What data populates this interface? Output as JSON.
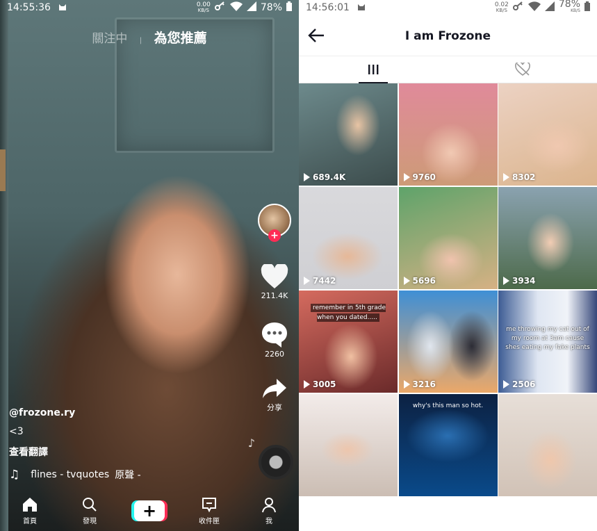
{
  "left": {
    "status": {
      "time": "14:55:36",
      "speed": "0.00",
      "speed_unit": "KB/S",
      "battery": "78%"
    },
    "feed_tabs": {
      "following": "關注中",
      "for_you": "為您推薦"
    },
    "rail": {
      "likes": "211.4K",
      "comments": "2260",
      "share": "分享"
    },
    "caption": {
      "username": "@frozone.ry",
      "text": "<3",
      "translate": "查看翻譯",
      "sound": "flines - tvquotes",
      "sound_original": "原聲 -"
    },
    "nav": {
      "home": "首頁",
      "discover": "發現",
      "create": "+",
      "inbox": "收件匣",
      "me": "我"
    }
  },
  "right": {
    "status": {
      "time": "14:56:01",
      "speed": "0.02",
      "speed_unit": "KB/S",
      "battery": "78%",
      "speed2_unit": "KB/S"
    },
    "header": {
      "title": "I am Frozone"
    },
    "grid": [
      {
        "views": "689.4K"
      },
      {
        "views": "9760"
      },
      {
        "views": "8302"
      },
      {
        "views": "7442"
      },
      {
        "views": "5696"
      },
      {
        "views": "3934"
      },
      {
        "views": "3005",
        "overlay": "remember in 5th grade when you dated....."
      },
      {
        "views": "3216"
      },
      {
        "views": "2506",
        "overlay": "me throwing my cat out of my room at 3am cause shes eating my fake plants"
      },
      {
        "views": ""
      },
      {
        "views": "",
        "overlay": "why's this man so hot."
      },
      {
        "views": ""
      }
    ]
  }
}
